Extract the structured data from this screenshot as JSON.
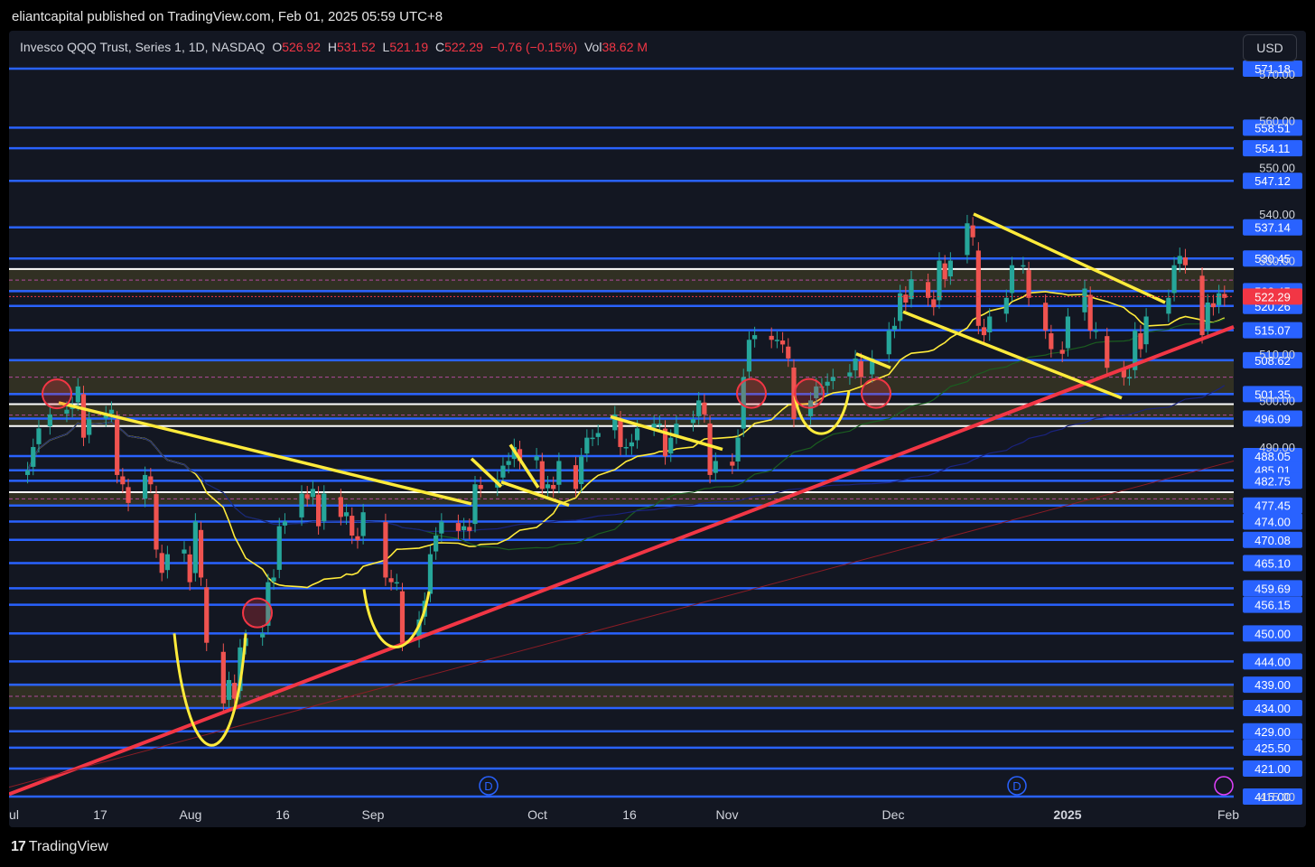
{
  "header": {
    "publisher_line": "eliantcapital published on TradingView.com, Feb 01, 2025 05:59 UTC+8"
  },
  "legend": {
    "symbol": "Invesco QQQ Trust, Series 1, 1D, NASDAQ",
    "o_label": "O",
    "o": "526.92",
    "h_label": "H",
    "h": "531.52",
    "l_label": "L",
    "l": "521.19",
    "c_label": "C",
    "c": "522.29",
    "change": "−0.76 (−0.15%)",
    "vol_label": "Vol",
    "vol": "38.62 M"
  },
  "currency_button": "USD",
  "footer": {
    "brand": "TradingView"
  },
  "colors": {
    "background": "#131722",
    "level_line": "#2962ff",
    "up": "#26a69a",
    "down": "#ef5350",
    "trend": "#f23645",
    "pattern": "#ffeb3b"
  },
  "chart_data": {
    "type": "candlestick",
    "title": "Invesco QQQ Trust, Series 1, 1D, NASDAQ",
    "last_close": 522.29,
    "ylim": [
      415,
      577
    ],
    "x_ticks": [
      "Jul",
      "17",
      "Aug",
      "16",
      "Sep",
      "Oct",
      "16",
      "Nov",
      "Dec",
      "2025",
      "Feb"
    ],
    "y_ticks": [
      415.0,
      490.0,
      500.0,
      510.0,
      530.0,
      540.0,
      550.0,
      560.0,
      570.0
    ],
    "price_levels": [
      571.18,
      558.51,
      554.11,
      547.12,
      537.14,
      530.45,
      523.45,
      520.26,
      515.07,
      508.62,
      501.35,
      496.09,
      488.05,
      485.01,
      482.75,
      477.45,
      474.0,
      470.08,
      465.1,
      459.69,
      456.15,
      450.0,
      444.0,
      439.0,
      434.0,
      429.0,
      425.5,
      421.0,
      415.0
    ],
    "zones": [
      [
        501.35,
        508.62
      ],
      [
        494.5,
        499.2
      ],
      [
        477.45,
        480.3
      ],
      [
        434.0,
        439.0
      ],
      [
        523.45,
        528.2
      ]
    ],
    "dividend_markers": [
      "D",
      "D"
    ],
    "annotations": [
      "red ascending trendline",
      "yellow descending trendlines",
      "yellow cup patterns",
      "red circle markers"
    ],
    "candles": [
      {
        "d": "2024-07-01",
        "c": 485
      },
      {
        "d": "2024-07-02",
        "c": 490
      },
      {
        "d": "2024-07-03",
        "c": 494
      },
      {
        "d": "2024-07-05",
        "c": 497
      },
      {
        "d": "2024-07-08",
        "c": 498
      },
      {
        "d": "2024-07-09",
        "c": 499
      },
      {
        "d": "2024-07-10",
        "c": 503
      },
      {
        "d": "2024-07-11",
        "c": 492
      },
      {
        "d": "2024-07-12",
        "c": 496
      },
      {
        "d": "2024-07-15",
        "c": 497
      },
      {
        "d": "2024-07-16",
        "c": 498
      },
      {
        "d": "2024-07-17",
        "c": 484
      },
      {
        "d": "2024-07-18",
        "c": 482
      },
      {
        "d": "2024-07-19",
        "c": 478
      },
      {
        "d": "2024-07-22",
        "c": 484
      },
      {
        "d": "2024-07-23",
        "c": 482
      },
      {
        "d": "2024-07-24",
        "c": 468
      },
      {
        "d": "2024-07-25",
        "c": 463
      },
      {
        "d": "2024-07-26",
        "c": 467
      },
      {
        "d": "2024-07-29",
        "c": 468
      },
      {
        "d": "2024-07-30",
        "c": 461
      },
      {
        "d": "2024-07-31",
        "c": 474
      },
      {
        "d": "2024-08-01",
        "c": 462
      },
      {
        "d": "2024-08-02",
        "c": 448
      },
      {
        "d": "2024-08-05",
        "c": 435
      },
      {
        "d": "2024-08-06",
        "c": 440
      },
      {
        "d": "2024-08-07",
        "c": 436
      },
      {
        "d": "2024-08-08",
        "c": 447
      },
      {
        "d": "2024-08-09",
        "c": 449
      },
      {
        "d": "2024-08-12",
        "c": 450
      },
      {
        "d": "2024-08-13",
        "c": 461
      },
      {
        "d": "2024-08-14",
        "c": 462
      },
      {
        "d": "2024-08-15",
        "c": 473
      },
      {
        "d": "2024-08-16",
        "c": 474
      },
      {
        "d": "2024-08-19",
        "c": 480
      },
      {
        "d": "2024-08-20",
        "c": 479
      },
      {
        "d": "2024-08-21",
        "c": 481
      },
      {
        "d": "2024-08-22",
        "c": 473
      },
      {
        "d": "2024-08-23",
        "c": 480
      },
      {
        "d": "2024-08-26",
        "c": 475
      },
      {
        "d": "2024-08-27",
        "c": 476
      },
      {
        "d": "2024-08-28",
        "c": 471
      },
      {
        "d": "2024-08-29",
        "c": 470
      },
      {
        "d": "2024-08-30",
        "c": 476
      },
      {
        "d": "2024-09-03",
        "c": 462
      },
      {
        "d": "2024-09-04",
        "c": 461
      },
      {
        "d": "2024-09-05",
        "c": 461
      },
      {
        "d": "2024-09-06",
        "c": 448
      },
      {
        "d": "2024-09-09",
        "c": 453
      },
      {
        "d": "2024-09-10",
        "c": 457
      },
      {
        "d": "2024-09-11",
        "c": 467
      },
      {
        "d": "2024-09-12",
        "c": 471
      },
      {
        "d": "2024-09-13",
        "c": 474
      },
      {
        "d": "2024-09-16",
        "c": 472
      },
      {
        "d": "2024-09-17",
        "c": 473
      },
      {
        "d": "2024-09-18",
        "c": 472
      },
      {
        "d": "2024-09-19",
        "c": 482
      },
      {
        "d": "2024-09-20",
        "c": 481
      },
      {
        "d": "2024-09-23",
        "c": 483
      },
      {
        "d": "2024-09-24",
        "c": 486
      },
      {
        "d": "2024-09-25",
        "c": 487
      },
      {
        "d": "2024-09-26",
        "c": 490
      },
      {
        "d": "2024-09-27",
        "c": 487
      },
      {
        "d": "2024-09-30",
        "c": 488
      },
      {
        "d": "2024-10-01",
        "c": 481
      },
      {
        "d": "2024-10-02",
        "c": 482
      },
      {
        "d": "2024-10-03",
        "c": 481
      },
      {
        "d": "2024-10-04",
        "c": 487
      },
      {
        "d": "2024-10-07",
        "c": 481
      },
      {
        "d": "2024-10-08",
        "c": 488
      },
      {
        "d": "2024-10-09",
        "c": 492
      },
      {
        "d": "2024-10-10",
        "c": 492
      },
      {
        "d": "2024-10-11",
        "c": 493
      },
      {
        "d": "2024-10-14",
        "c": 497
      },
      {
        "d": "2024-10-15",
        "c": 490
      },
      {
        "d": "2024-10-16",
        "c": 490
      },
      {
        "d": "2024-10-17",
        "c": 491
      },
      {
        "d": "2024-10-18",
        "c": 494
      },
      {
        "d": "2024-10-21",
        "c": 495
      },
      {
        "d": "2024-10-22",
        "c": 495
      },
      {
        "d": "2024-10-23",
        "c": 488
      },
      {
        "d": "2024-10-24",
        "c": 492
      },
      {
        "d": "2024-10-25",
        "c": 495
      },
      {
        "d": "2024-10-28",
        "c": 496
      },
      {
        "d": "2024-10-29",
        "c": 500
      },
      {
        "d": "2024-10-30",
        "c": 497
      },
      {
        "d": "2024-10-31",
        "c": 484
      },
      {
        "d": "2024-11-01",
        "c": 487
      },
      {
        "d": "2024-11-04",
        "c": 486
      },
      {
        "d": "2024-11-05",
        "c": 492
      },
      {
        "d": "2024-11-06",
        "c": 505
      },
      {
        "d": "2024-11-07",
        "c": 513
      },
      {
        "d": "2024-11-08",
        "c": 514
      },
      {
        "d": "2024-11-11",
        "c": 513
      },
      {
        "d": "2024-11-12",
        "c": 513
      },
      {
        "d": "2024-11-13",
        "c": 512
      },
      {
        "d": "2024-11-14",
        "c": 509
      },
      {
        "d": "2024-11-15",
        "c": 496
      },
      {
        "d": "2024-11-18",
        "c": 500
      },
      {
        "d": "2024-11-19",
        "c": 503
      },
      {
        "d": "2024-11-20",
        "c": 503
      },
      {
        "d": "2024-11-21",
        "c": 504
      },
      {
        "d": "2024-11-22",
        "c": 505
      },
      {
        "d": "2024-11-25",
        "c": 506
      },
      {
        "d": "2024-11-26",
        "c": 509
      },
      {
        "d": "2024-11-27",
        "c": 505
      },
      {
        "d": "2024-11-29",
        "c": 509
      },
      {
        "d": "2024-12-02",
        "c": 515
      },
      {
        "d": "2024-12-03",
        "c": 516
      },
      {
        "d": "2024-12-04",
        "c": 523
      },
      {
        "d": "2024-12-05",
        "c": 521
      },
      {
        "d": "2024-12-06",
        "c": 526
      },
      {
        "d": "2024-12-09",
        "c": 522
      },
      {
        "d": "2024-12-10",
        "c": 520
      },
      {
        "d": "2024-12-11",
        "c": 530
      },
      {
        "d": "2024-12-12",
        "c": 526
      },
      {
        "d": "2024-12-13",
        "c": 530
      },
      {
        "d": "2024-12-16",
        "c": 538
      },
      {
        "d": "2024-12-17",
        "c": 535
      },
      {
        "d": "2024-12-18",
        "c": 516
      },
      {
        "d": "2024-12-19",
        "c": 514
      },
      {
        "d": "2024-12-20",
        "c": 518
      },
      {
        "d": "2024-12-23",
        "c": 522
      },
      {
        "d": "2024-12-24",
        "c": 529
      },
      {
        "d": "2024-12-26",
        "c": 529
      },
      {
        "d": "2024-12-27",
        "c": 522
      },
      {
        "d": "2024-12-30",
        "c": 515
      },
      {
        "d": "2024-12-31",
        "c": 511
      },
      {
        "d": "2025-01-02",
        "c": 510
      },
      {
        "d": "2025-01-03",
        "c": 518
      },
      {
        "d": "2025-01-06",
        "c": 524
      },
      {
        "d": "2025-01-07",
        "c": 515
      },
      {
        "d": "2025-01-08",
        "c": 515
      },
      {
        "d": "2025-01-10",
        "c": 507
      },
      {
        "d": "2025-01-13",
        "c": 505
      },
      {
        "d": "2025-01-14",
        "c": 505
      },
      {
        "d": "2025-01-15",
        "c": 515
      },
      {
        "d": "2025-01-16",
        "c": 511
      },
      {
        "d": "2025-01-17",
        "c": 518
      },
      {
        "d": "2025-01-21",
        "c": 522
      },
      {
        "d": "2025-01-22",
        "c": 529
      },
      {
        "d": "2025-01-23",
        "c": 531
      },
      {
        "d": "2025-01-24",
        "c": 529
      },
      {
        "d": "2025-01-27",
        "c": 514
      },
      {
        "d": "2025-01-28",
        "c": 521
      },
      {
        "d": "2025-01-29",
        "c": 520
      },
      {
        "d": "2025-01-30",
        "c": 523
      },
      {
        "d": "2025-01-31",
        "c": 522
      }
    ]
  }
}
